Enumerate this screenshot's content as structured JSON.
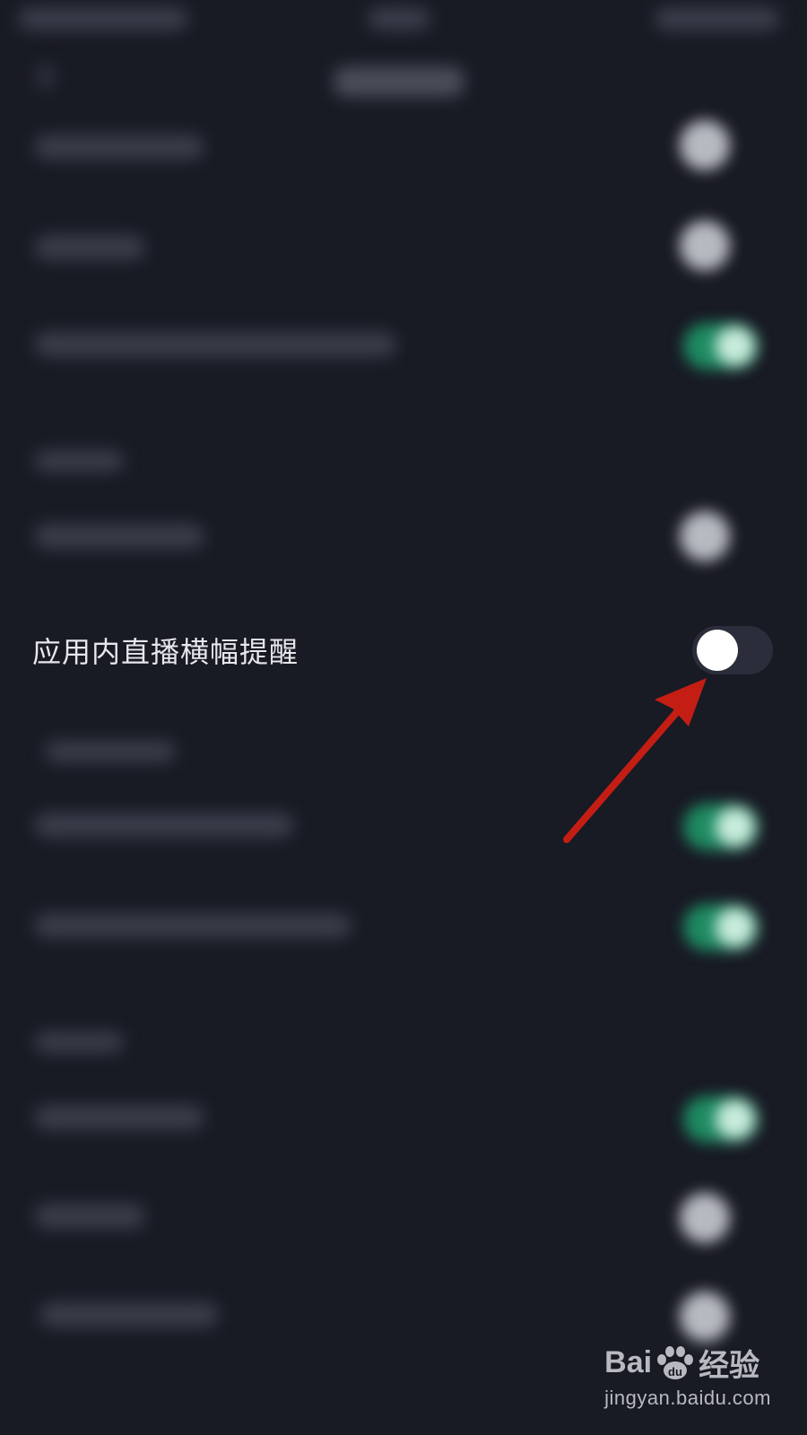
{
  "settings": {
    "focused_item": {
      "label": "应用内直播横幅提醒",
      "toggle_on": false
    }
  },
  "colors": {
    "background": "#181a24",
    "toggle_on": "#1e8a62",
    "toggle_off_track": "#2b2e3a",
    "annotation_arrow": "#c41e14"
  },
  "watermark": {
    "logo_text_left": "Bai",
    "logo_text_right": "经验",
    "url": "jingyan.baidu.com"
  }
}
